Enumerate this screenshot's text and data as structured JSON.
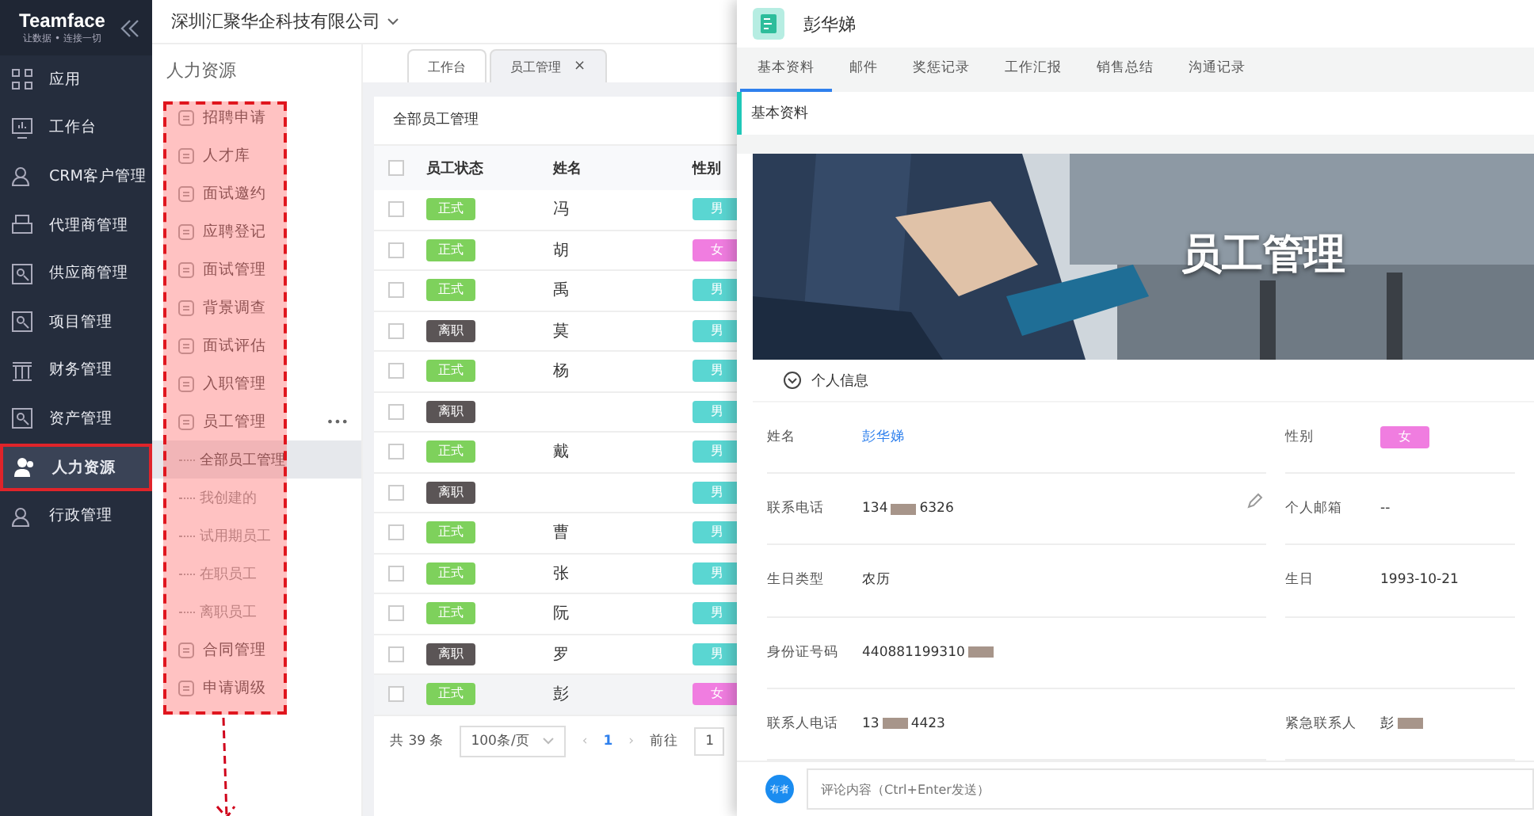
{
  "brand": {
    "name": "Teamface",
    "slogan": "让数据 • 连接一切"
  },
  "company": "深圳汇聚华企科技有限公司",
  "sidebar": {
    "items": [
      {
        "label": "应用",
        "selected": false
      },
      {
        "label": "工作台",
        "selected": false
      },
      {
        "label": "CRM客户管理",
        "selected": false
      },
      {
        "label": "代理商管理",
        "selected": false
      },
      {
        "label": "供应商管理",
        "selected": false
      },
      {
        "label": "项目管理",
        "selected": false
      },
      {
        "label": "财务管理",
        "selected": false
      },
      {
        "label": "资产管理",
        "selected": false
      },
      {
        "label": "人力资源",
        "selected": true
      },
      {
        "label": "行政管理",
        "selected": false
      }
    ]
  },
  "module_menu": {
    "title": "人力资源",
    "items": [
      {
        "label": "招聘申请",
        "selected": false
      },
      {
        "label": "人才库",
        "selected": false
      },
      {
        "label": "面试邀约",
        "selected": false
      },
      {
        "label": "应聘登记",
        "selected": false
      },
      {
        "label": "面试管理",
        "selected": false
      },
      {
        "label": "背景调查",
        "selected": false
      },
      {
        "label": "面试评估",
        "selected": false
      },
      {
        "label": "入职管理",
        "selected": false
      },
      {
        "label": "员工管理",
        "selected": false,
        "more": "•••",
        "children": [
          {
            "label": "全部员工管理",
            "selected": true
          },
          {
            "label": "我创建的",
            "selected": false
          },
          {
            "label": "试用期员工",
            "selected": false
          },
          {
            "label": "在职员工",
            "selected": false
          },
          {
            "label": "离职员工",
            "selected": false
          }
        ]
      },
      {
        "label": "合同管理",
        "selected": false
      },
      {
        "label": "申请调级",
        "selected": false
      }
    ]
  },
  "page_tabs": [
    {
      "label": "工作台",
      "selected": false
    },
    {
      "label": "员工管理",
      "selected": true,
      "close": "×"
    }
  ],
  "table": {
    "title": "全部员工管理",
    "all_checked": false,
    "columns": [
      "员工状态",
      "姓名",
      "性别"
    ],
    "rows": [
      {
        "checked": false,
        "status": "正式",
        "kind": "active",
        "name": "冯",
        "gender": "男",
        "color": "#5ad6d2",
        "selected": false
      },
      {
        "checked": false,
        "status": "正式",
        "kind": "active",
        "name": "胡",
        "gender": "女",
        "color": "#f07de0",
        "selected": false
      },
      {
        "checked": false,
        "status": "正式",
        "kind": "active",
        "name": "禹",
        "gender": "男",
        "color": "#5ad6d2",
        "selected": false
      },
      {
        "checked": false,
        "status": "离职",
        "kind": "left",
        "name": "莫",
        "gender": "男",
        "color": "#5ad6d2",
        "selected": false
      },
      {
        "checked": false,
        "status": "正式",
        "kind": "active",
        "name": "杨",
        "gender": "男",
        "color": "#5ad6d2",
        "selected": false
      },
      {
        "checked": false,
        "status": "离职",
        "kind": "left",
        "gender": "男",
        "color": "#5ad6d2",
        "selected": false
      },
      {
        "checked": false,
        "status": "正式",
        "kind": "active",
        "name": "戴",
        "gender": "男",
        "color": "#5ad6d2",
        "selected": false
      },
      {
        "checked": false,
        "status": "离职",
        "kind": "left",
        "gender": "男",
        "color": "#5ad6d2",
        "selected": false
      },
      {
        "checked": false,
        "status": "正式",
        "kind": "active",
        "name": "曹",
        "gender": "男",
        "color": "#5ad6d2",
        "selected": false
      },
      {
        "checked": false,
        "status": "正式",
        "kind": "active",
        "name": "张",
        "gender": "男",
        "color": "#5ad6d2",
        "selected": false
      },
      {
        "checked": false,
        "status": "正式",
        "kind": "active",
        "name": "阮",
        "gender": "男",
        "color": "#5ad6d2",
        "selected": false
      },
      {
        "checked": false,
        "status": "离职",
        "kind": "left",
        "name": "罗",
        "gender": "男",
        "color": "#5ad6d2",
        "selected": false
      },
      {
        "checked": false,
        "status": "正式",
        "kind": "active",
        "name": "彭",
        "gender": "女",
        "color": "#f07de0",
        "selected": true
      }
    ]
  },
  "pagination": {
    "total": "共 39 条",
    "page_size": "100条/页",
    "prev": "‹",
    "page": "1",
    "next": "›",
    "goto_label": "前往",
    "goto_value": "1"
  },
  "detail": {
    "title": "彭华娣",
    "tabs": [
      {
        "label": "基本资料",
        "selected": true
      },
      {
        "label": "邮件",
        "selected": false
      },
      {
        "label": "奖惩记录",
        "selected": false
      },
      {
        "label": "工作汇报",
        "selected": false
      },
      {
        "label": "销售总结",
        "selected": false
      },
      {
        "label": "沟通记录",
        "selected": false
      }
    ],
    "section": "基本资料",
    "banner": {
      "kind": "picture",
      "caption": "员工管理"
    },
    "group": "个人信息",
    "fields": [
      {
        "label": "姓名",
        "value": "彭华娣",
        "kind": "link"
      },
      {
        "label": "性别",
        "value": "女",
        "kind": "tag"
      },
      {
        "label": "联系电话",
        "prefix": "134",
        "suffix": "6326",
        "kind": "masked",
        "editable": true
      },
      {
        "label": "个人邮箱",
        "value": "--",
        "kind": "text"
      },
      {
        "label": "生日类型",
        "value": "农历",
        "kind": "text"
      },
      {
        "label": "生日",
        "value": "1993-10-21",
        "kind": "text"
      },
      {
        "label": "身份证号码",
        "prefix": "440881199310",
        "kind": "masked"
      },
      {
        "label": "联系人电话",
        "prefix": "13",
        "suffix": "4423",
        "kind": "masked"
      },
      {
        "label": "紧急联系人",
        "prefix": "彭",
        "kind": "masked"
      }
    ],
    "comment": {
      "avatar": "有者",
      "placeholder": "评论内容（Ctrl+Enter发送）"
    }
  }
}
